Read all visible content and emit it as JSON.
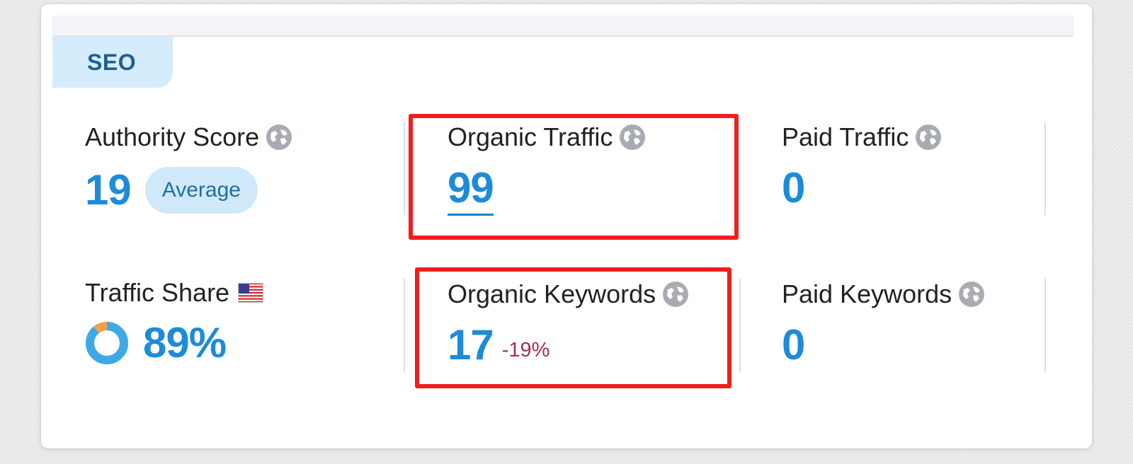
{
  "section_tab": "SEO",
  "metrics": {
    "authority_score": {
      "label": "Authority Score",
      "value": "19",
      "badge": "Average"
    },
    "organic_traffic": {
      "label": "Organic Traffic",
      "value": "99"
    },
    "paid_traffic": {
      "label": "Paid Traffic",
      "value": "0"
    },
    "traffic_share": {
      "label": "Traffic Share",
      "value": "89%",
      "share_fraction": 0.89
    },
    "organic_keywords": {
      "label": "Organic Keywords",
      "value": "17",
      "change": "-19%"
    },
    "paid_keywords": {
      "label": "Paid Keywords",
      "value": "0"
    }
  },
  "icons": {
    "globe": "globe-icon",
    "flag": "us-flag-icon"
  },
  "colors": {
    "value_blue": "#1e8bd8",
    "badge_bg": "#cfe9fb",
    "highlight_red": "#f21d1d",
    "negative_change": "#a23058",
    "donut_blue": "#3fa9e8",
    "donut_orange": "#f4a04a"
  }
}
